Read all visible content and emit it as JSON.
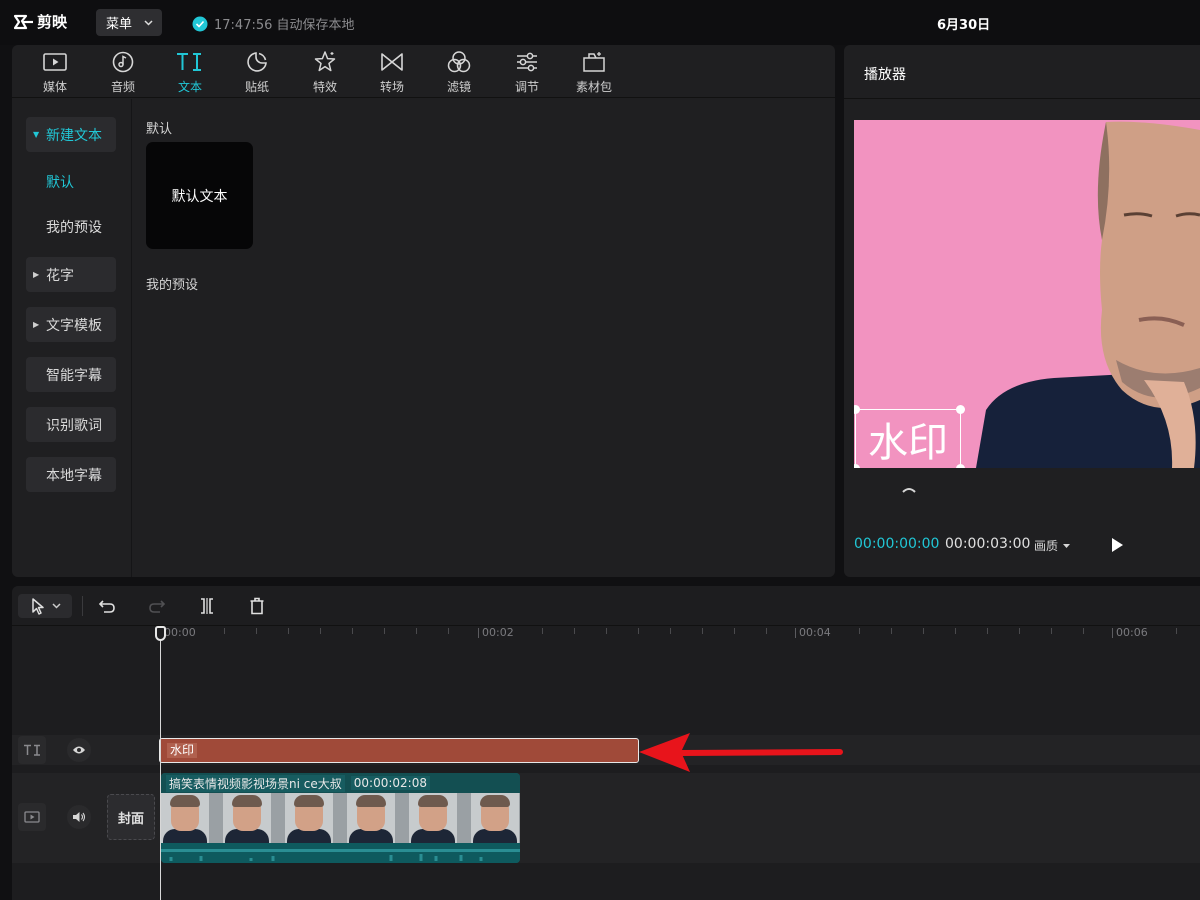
{
  "app": {
    "logo_text": "剪映",
    "menu_label": "菜单",
    "autosave_text": "17:47:56 自动保存本地",
    "date": "6月30日"
  },
  "tabs": [
    {
      "label": "媒体",
      "icon": "media-icon"
    },
    {
      "label": "音频",
      "icon": "audio-icon"
    },
    {
      "label": "文本",
      "icon": "text-icon",
      "active": true
    },
    {
      "label": "贴纸",
      "icon": "sticker-icon"
    },
    {
      "label": "特效",
      "icon": "effects-icon"
    },
    {
      "label": "转场",
      "icon": "transition-icon"
    },
    {
      "label": "滤镜",
      "icon": "filter-icon"
    },
    {
      "label": "调节",
      "icon": "adjust-icon"
    },
    {
      "label": "素材包",
      "icon": "material-pack-icon"
    }
  ],
  "categories": {
    "new_text": "新建文本",
    "default": "默认",
    "my_presets": "我的预设",
    "fancy_text": "花字",
    "text_template": "文字模板",
    "smart_subtitle": "智能字幕",
    "recognize_lyrics": "识别歌词",
    "local_subtitle": "本地字幕"
  },
  "content": {
    "section_default": "默认",
    "default_card": "默认文本",
    "section_presets": "我的预设"
  },
  "player": {
    "title": "播放器",
    "watermark_text": "水印",
    "time_current": "00:00:00:00",
    "time_total": "00:00:03:00",
    "quality_label": "画质"
  },
  "timeline": {
    "ruler_labels": [
      "00:00",
      "00:02",
      "00:04",
      "00:06"
    ],
    "text_clip_label": "水印",
    "video_clip_name": "搞笑表情视频影视场景ni ce大叔",
    "video_clip_duration": "00:00:02:08",
    "cover_label": "封面"
  },
  "colors": {
    "accent": "#21c7d6",
    "text_clip": "#a04a39",
    "video_clip": "#0e5a5e",
    "canvas_bg": "#f293c0",
    "annotation_arrow": "#e8141b"
  }
}
